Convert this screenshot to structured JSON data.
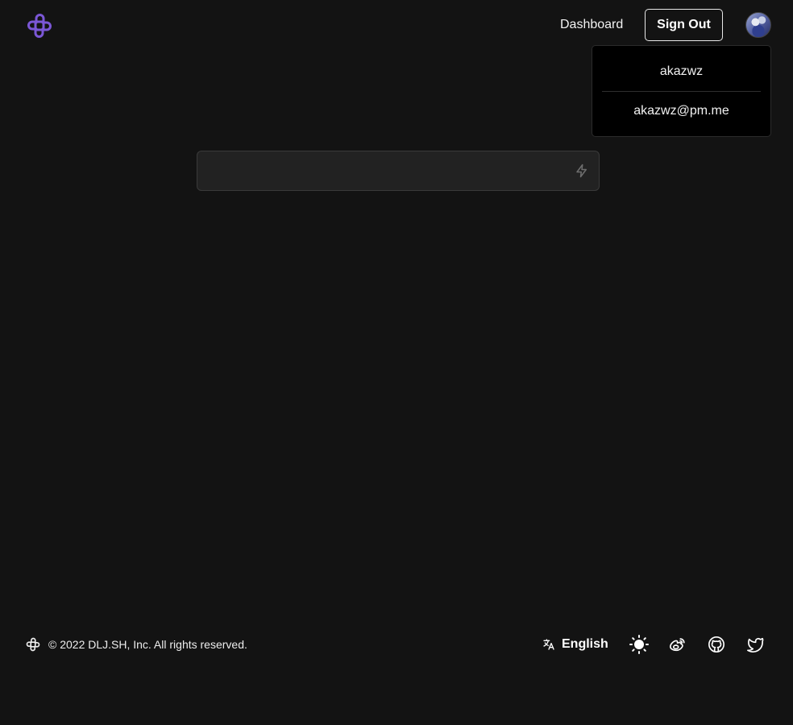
{
  "header": {
    "logo_icon": "dljsh-logo-icon",
    "dashboard_link": "Dashboard",
    "sign_out_label": "Sign Out",
    "avatar_icon": "user-avatar"
  },
  "user_menu": {
    "username": "akazwz",
    "email": "akazwz@pm.me"
  },
  "command_input": {
    "value": "",
    "placeholder": "",
    "icon": "lightning-bolt-icon"
  },
  "footer": {
    "copyright": "© 2022 DLJ.SH, Inc. All rights reserved.",
    "language_label": "English",
    "icons": [
      "translate-icon",
      "sun-icon",
      "weibo-icon",
      "github-icon",
      "twitter-icon"
    ]
  },
  "colors": {
    "background": "#131313",
    "brand_purple": "#7b57d6",
    "text": "#f2f2f2",
    "dropdown_bg": "#000000",
    "input_bg": "#222222"
  }
}
